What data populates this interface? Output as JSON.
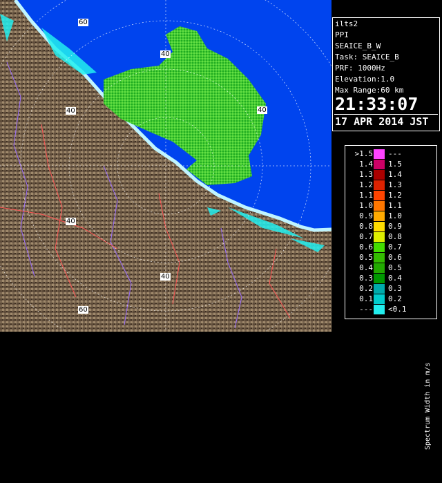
{
  "info": {
    "radar": "ilts2",
    "display": "PPI",
    "product": "SEAICE_B_W",
    "task": "Task: SEAICE_B",
    "prf": "PRF: 1000Hz",
    "elevation": "Elevation:1.0",
    "max_range": "Max Range:60 km",
    "time": "21:33:07",
    "date": "17 APR 2014 JST"
  },
  "legend": {
    "units": "Spectrum Width in m/s",
    "rows": [
      {
        "lo": ">1.5",
        "hi": "---",
        "color": "#ff44ff"
      },
      {
        "lo": "1.4",
        "hi": "1.5",
        "color": "#cc0066"
      },
      {
        "lo": "1.3",
        "hi": "1.4",
        "color": "#aa0000"
      },
      {
        "lo": "1.2",
        "hi": "1.3",
        "color": "#dd2200"
      },
      {
        "lo": "1.1",
        "hi": "1.2",
        "color": "#ff4400"
      },
      {
        "lo": "1.0",
        "hi": "1.1",
        "color": "#ff7700"
      },
      {
        "lo": "0.9",
        "hi": "1.0",
        "color": "#ffaa00"
      },
      {
        "lo": "0.8",
        "hi": "0.9",
        "color": "#ffdd00"
      },
      {
        "lo": "0.7",
        "hi": "0.8",
        "color": "#ddee00"
      },
      {
        "lo": "0.6",
        "hi": "0.7",
        "color": "#44dd00"
      },
      {
        "lo": "0.5",
        "hi": "0.6",
        "color": "#33bb00"
      },
      {
        "lo": "0.4",
        "hi": "0.5",
        "color": "#22aa00"
      },
      {
        "lo": "0.3",
        "hi": "0.4",
        "color": "#009900"
      },
      {
        "lo": "0.2",
        "hi": "0.3",
        "color": "#00aaaa"
      },
      {
        "lo": "0.1",
        "hi": "0.2",
        "color": "#00cccc"
      },
      {
        "lo": "---",
        "hi": "<0.1",
        "color": "#22eeee"
      }
    ]
  },
  "range_rings": {
    "labels": [
      "60",
      "40",
      "40",
      "40",
      "40",
      "40",
      "60"
    ]
  },
  "colors": {
    "sea": "#0044ee",
    "land": "#7a6650",
    "echo": "#44cc33",
    "coast": "#bff4ff",
    "ring": "#ffffff"
  }
}
